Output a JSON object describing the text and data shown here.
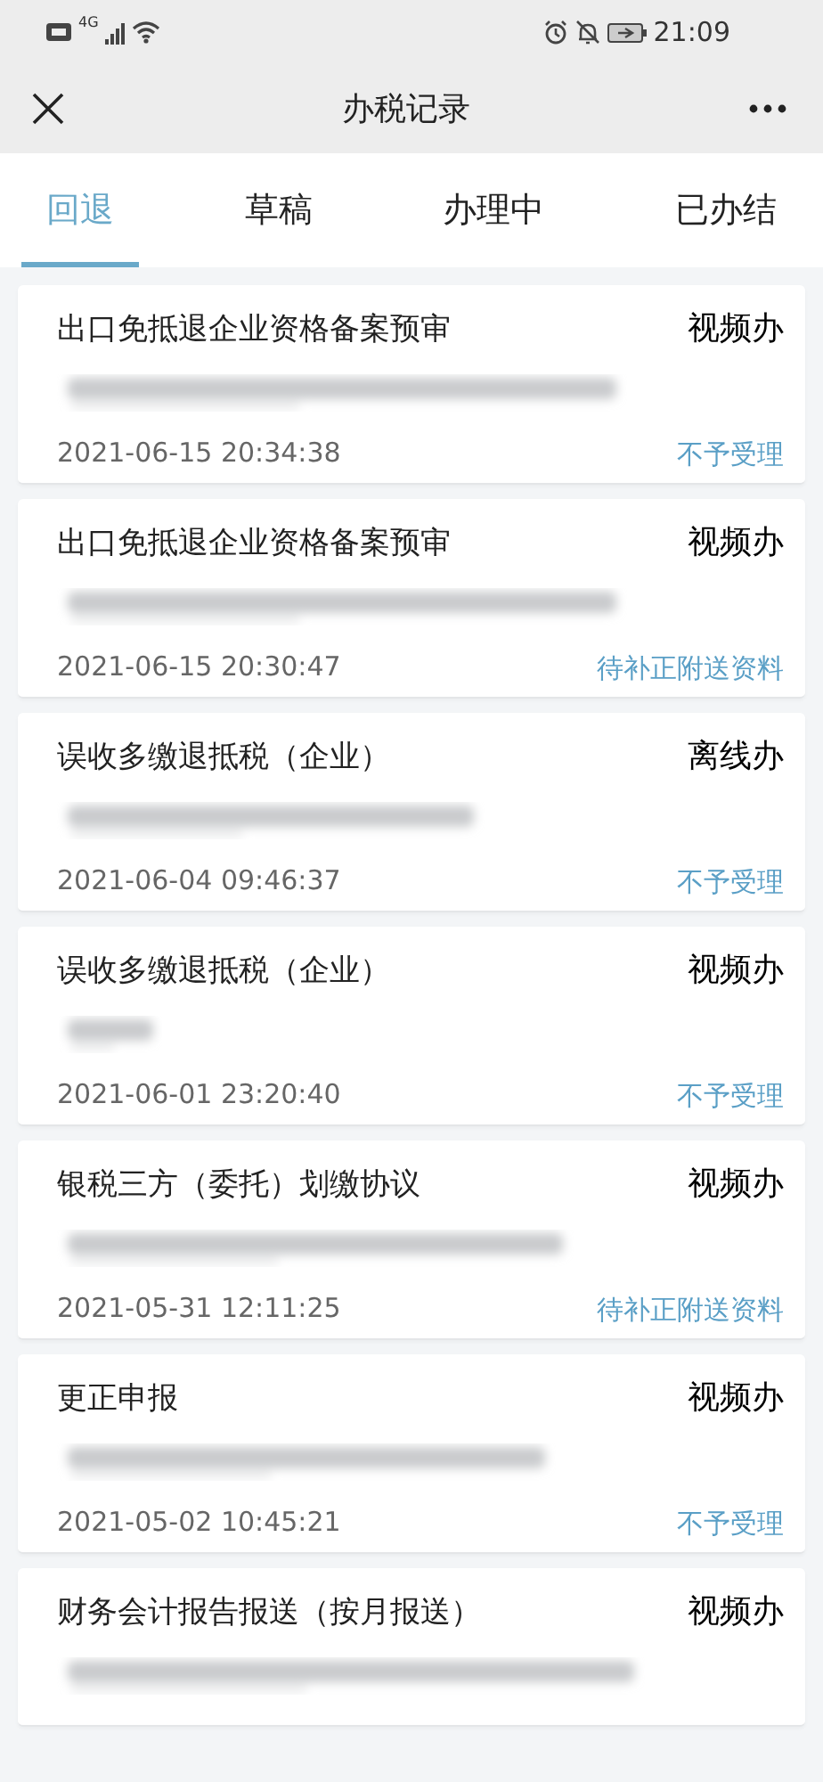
{
  "status_bar": {
    "network": "4G",
    "time": "21:09"
  },
  "header": {
    "title": "办税记录"
  },
  "tabs": [
    {
      "label": "回退",
      "selected": true
    },
    {
      "label": "草稿",
      "selected": false
    },
    {
      "label": "办理中",
      "selected": false
    },
    {
      "label": "已办结",
      "selected": false
    }
  ],
  "records": [
    {
      "title": "出口免抵退企业资格备案预审",
      "method": "视频办",
      "company": {
        "kind": "blurred"
      },
      "time": "2021-06-15 20:34:38",
      "status": "不予受理"
    },
    {
      "title": "出口免抵退企业资格备案预审",
      "method": "视频办",
      "company": {
        "kind": "blurred"
      },
      "time": "2021-06-15 20:30:47",
      "status": "待补正附送资料"
    },
    {
      "title": "误收多缴退抵税（企业）",
      "method": "离线办",
      "company": {
        "kind": "blurred"
      },
      "time": "2021-06-04 09:46:37",
      "status": "不予受理"
    },
    {
      "title": "误收多缴退抵税（企业）",
      "method": "视频办",
      "company": {
        "kind": "blurred"
      },
      "time": "2021-06-01 23:20:40",
      "status": "不予受理"
    },
    {
      "title": "银税三方（委托）划缴协议",
      "method": "视频办",
      "company": {
        "kind": "blurred"
      },
      "time": "2021-05-31 12:11:25",
      "status": "待补正附送资料"
    },
    {
      "title": "更正申报",
      "method": "视频办",
      "company": {
        "kind": "blurred"
      },
      "time": "2021-05-02 10:45:21",
      "status": "不予受理"
    },
    {
      "title": "财务会计报告报送（按月报送）",
      "method": "视频办",
      "company": {
        "kind": "blurred"
      }
    }
  ]
}
